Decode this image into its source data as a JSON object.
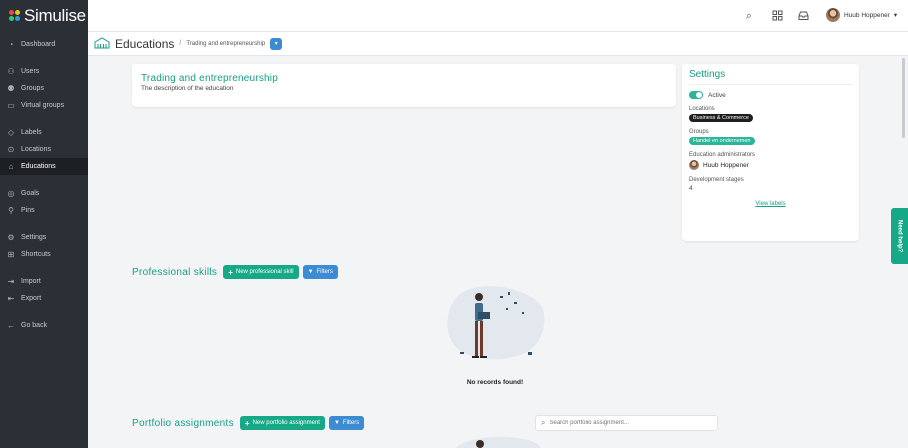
{
  "brand": {
    "name": "Simulise",
    "colors": [
      "#e74c3c",
      "#f1c40f",
      "#2ecc71",
      "#3498db"
    ]
  },
  "sidebar": {
    "items": [
      {
        "label": "Dashboard",
        "icon": "dashboard-icon",
        "glyph": "◔"
      },
      {
        "label": "Users",
        "icon": "user-icon",
        "glyph": "⚇"
      },
      {
        "label": "Groups",
        "icon": "users-icon",
        "glyph": "⚉"
      },
      {
        "label": "Virtual groups",
        "icon": "briefcase-icon",
        "glyph": "▭"
      },
      {
        "label": "Labels",
        "icon": "tag-icon",
        "glyph": "◇"
      },
      {
        "label": "Locations",
        "icon": "map-pin-icon",
        "glyph": "⊙"
      },
      {
        "label": "Educations",
        "icon": "school-icon",
        "glyph": "⌂",
        "active": true
      },
      {
        "label": "Goals",
        "icon": "target-icon",
        "glyph": "◎"
      },
      {
        "label": "Pins",
        "icon": "pin-icon",
        "glyph": "⚲"
      },
      {
        "label": "Settings",
        "icon": "gear-icon",
        "glyph": "⚙"
      },
      {
        "label": "Shortcuts",
        "icon": "grid-icon",
        "glyph": "⊞"
      },
      {
        "label": "Import",
        "icon": "import-icon",
        "glyph": "⇥"
      },
      {
        "label": "Export",
        "icon": "export-icon",
        "glyph": "⇤"
      },
      {
        "label": "Go back",
        "icon": "arrow-left-icon",
        "glyph": "←"
      }
    ]
  },
  "header": {
    "user_name": "Huub Hoppener"
  },
  "breadcrumb": {
    "title": "Educations",
    "separator": "/",
    "current": "Trading and entrepreneurship"
  },
  "education": {
    "title": "Trading and entrepreneurship",
    "description": "The description of the education"
  },
  "settings": {
    "title": "Settings",
    "active_label": "Active",
    "locations_label": "Locations",
    "location": "Business & Commerce",
    "groups_label": "Groups",
    "group": "Handel en ondernemen",
    "admins_label": "Education administrators",
    "admin": "Huub Hoppener",
    "stages_label": "Development stages",
    "stages_value": "4",
    "view_labels": "View labels"
  },
  "skills": {
    "title": "Professional skills",
    "new_button": "New professional skill",
    "filters_button": "Filters",
    "empty": "No records found!"
  },
  "portfolio": {
    "title": "Portfolio assignments",
    "new_button": "New portfolio assignment",
    "filters_button": "Filters",
    "search_placeholder": "Search portfolio assignment..."
  },
  "help": {
    "label": "Need help?"
  },
  "colors": {
    "accent": "#16a085",
    "button_green": "#17a887",
    "button_blue": "#3d8bd2",
    "sidebar": "#2b2f36"
  }
}
